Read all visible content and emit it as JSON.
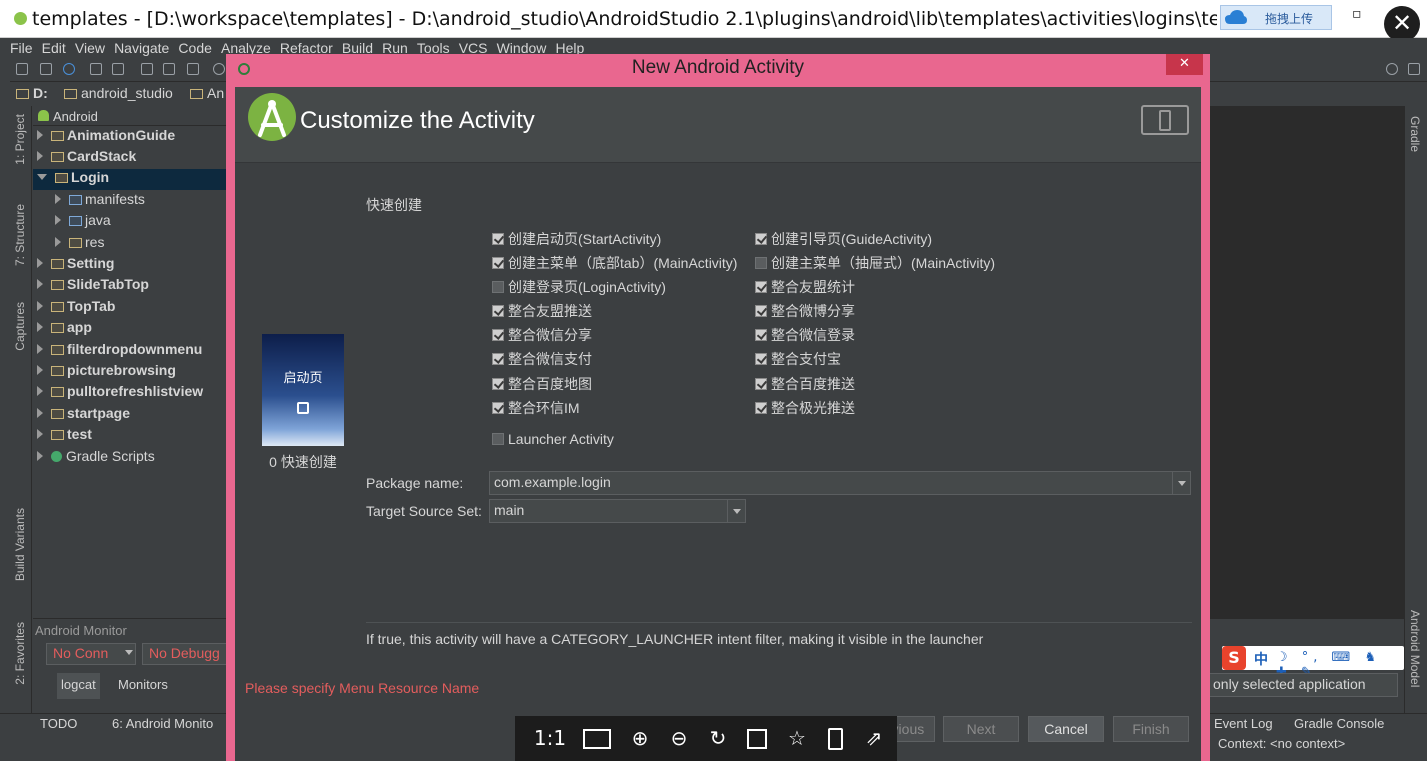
{
  "window": {
    "title": "templates - [D:\\workspace\\templates] - D:\\android_studio\\AndroidStudio 2.1\\plugins\\android\\lib\\templates\\activities\\logins\\template",
    "upload_label": "拖拽上传",
    "minimize_glyph": "▫",
    "close_glyph": "✕"
  },
  "menu": [
    "File",
    "Edit",
    "View",
    "Navigate",
    "Code",
    "Analyze",
    "Refactor",
    "Build",
    "Run",
    "Tools",
    "VCS",
    "Window",
    "Help"
  ],
  "breadcrumb": [
    "D:",
    "android_studio",
    "An"
  ],
  "left_tabs": [
    "1: Project",
    "7: Structure",
    "Captures",
    "Build Variants",
    "2: Favorites"
  ],
  "project_panel": {
    "view": "Android",
    "items": [
      {
        "label": "AnimationGuide",
        "bold": true,
        "level": 0,
        "open": false
      },
      {
        "label": "CardStack",
        "bold": true,
        "level": 0,
        "open": false
      },
      {
        "label": "Login",
        "bold": true,
        "level": 0,
        "open": true,
        "selected": true
      },
      {
        "label": "manifests",
        "bold": false,
        "level": 1,
        "open": false
      },
      {
        "label": "java",
        "bold": false,
        "level": 1,
        "open": false
      },
      {
        "label": "res",
        "bold": false,
        "level": 1,
        "open": false
      },
      {
        "label": "Setting",
        "bold": true,
        "level": 0,
        "open": false
      },
      {
        "label": "SlideTabTop",
        "bold": true,
        "level": 0,
        "open": false
      },
      {
        "label": "TopTab",
        "bold": true,
        "level": 0,
        "open": false
      },
      {
        "label": "app",
        "bold": true,
        "level": 0,
        "open": false
      },
      {
        "label": "filterdropdownmenu",
        "bold": true,
        "level": 0,
        "open": false
      },
      {
        "label": "picturebrowsing",
        "bold": true,
        "level": 0,
        "open": false
      },
      {
        "label": "pulltorefreshlistview",
        "bold": true,
        "level": 0,
        "open": false
      },
      {
        "label": "startpage",
        "bold": true,
        "level": 0,
        "open": false
      },
      {
        "label": "test",
        "bold": true,
        "level": 0,
        "open": false
      },
      {
        "label": "Gradle Scripts",
        "bold": false,
        "level": 0,
        "open": false
      }
    ]
  },
  "android_monitor": {
    "title": "Android Monitor",
    "device_combo": "No Conn",
    "process_combo": "No Debugg",
    "tabs": [
      "logcat",
      "Monitors"
    ]
  },
  "statusbar": {
    "left_tabs": [
      "TODO",
      "6: Android Monito"
    ],
    "right_tabs": [
      "Event Log",
      "Gradle Console"
    ],
    "context": "Context: <no context>"
  },
  "right_panel": {
    "filter": "only selected application",
    "right_tabs": [
      "Gradle",
      "Android Model"
    ]
  },
  "ime": {
    "logo": "S",
    "mode": "中",
    "icons": "☽ °, ⌨ ♞ ✚ ✎"
  },
  "dialog": {
    "title": "New Android Activity",
    "heading": "Customize the Activity",
    "quick_create_label": "快速创建",
    "thumbnail_text": "启动页",
    "thumbnail_caption": "0 快速创建",
    "options_left": [
      {
        "label": "创建启动页(StartActivity)",
        "checked": true
      },
      {
        "label": "创建主菜单（底部tab）(MainActivity)",
        "checked": true
      },
      {
        "label": "创建登录页(LoginActivity)",
        "checked": false
      },
      {
        "label": "整合友盟推送",
        "checked": true
      },
      {
        "label": "整合微信分享",
        "checked": true
      },
      {
        "label": "整合微信支付",
        "checked": true
      },
      {
        "label": "整合百度地图",
        "checked": true
      },
      {
        "label": "整合环信IM",
        "checked": true
      }
    ],
    "options_right": [
      {
        "label": "创建引导页(GuideActivity)",
        "checked": true
      },
      {
        "label": "创建主菜单（抽屉式）(MainActivity)",
        "checked": false
      },
      {
        "label": "整合友盟统计",
        "checked": true
      },
      {
        "label": "整合微博分享",
        "checked": true
      },
      {
        "label": "整合微信登录",
        "checked": true
      },
      {
        "label": "整合支付宝",
        "checked": true
      },
      {
        "label": "整合百度推送",
        "checked": true
      },
      {
        "label": "整合极光推送",
        "checked": true
      }
    ],
    "launcher": {
      "label": "Launcher Activity",
      "checked": false
    },
    "package_label": "Package name:",
    "package_value": "com.example.login",
    "source_set_label": "Target Source Set:",
    "source_set_value": "main",
    "hint": "If true, this activity will have a CATEGORY_LAUNCHER intent filter, making it visible in the launcher",
    "warning": "Please specify Menu Resource Name",
    "buttons": {
      "previous": "Previous",
      "next": "Next",
      "cancel": "Cancel",
      "finish": "Finish"
    }
  },
  "viewer": {
    "actual_size": "1:1"
  }
}
